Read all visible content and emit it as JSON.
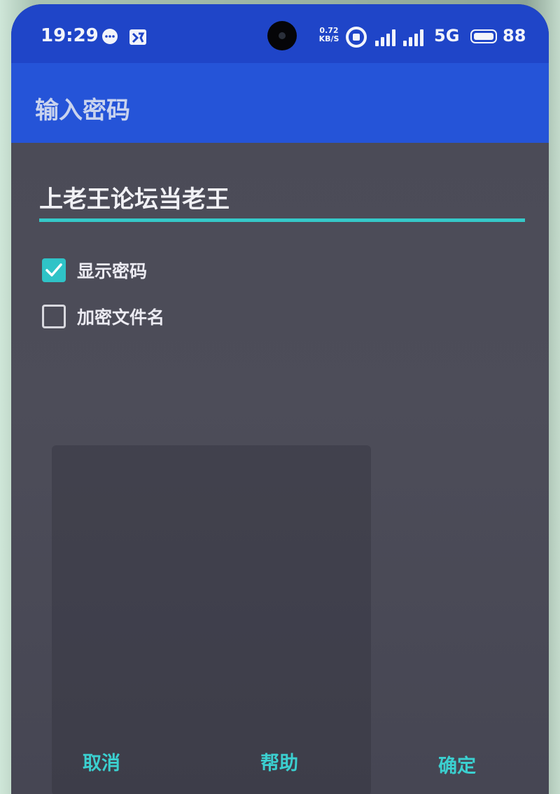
{
  "status_bar": {
    "time": "19:29",
    "net_speed_value": "0.72",
    "net_speed_unit": "KB/S",
    "network_type": "5G",
    "battery_level": "88",
    "icons": [
      "message-icon",
      "gallery-icon",
      "sync-icon",
      "signal-icon",
      "signal-icon",
      "battery-icon"
    ]
  },
  "app_bar": {
    "title": "输入密码"
  },
  "form": {
    "password_value": "上老王论坛当老王",
    "show_password_label": "显示密码",
    "show_password_checked": true,
    "encrypt_filename_label": "加密文件名",
    "encrypt_filename_checked": false
  },
  "actions": {
    "cancel_label": "取消",
    "help_label": "帮助",
    "confirm_label": "确定"
  },
  "colors": {
    "status_bar": "#1f45c8",
    "app_bar": "#2554d8",
    "background": "#4b4b57",
    "accent": "#35c9c9"
  }
}
